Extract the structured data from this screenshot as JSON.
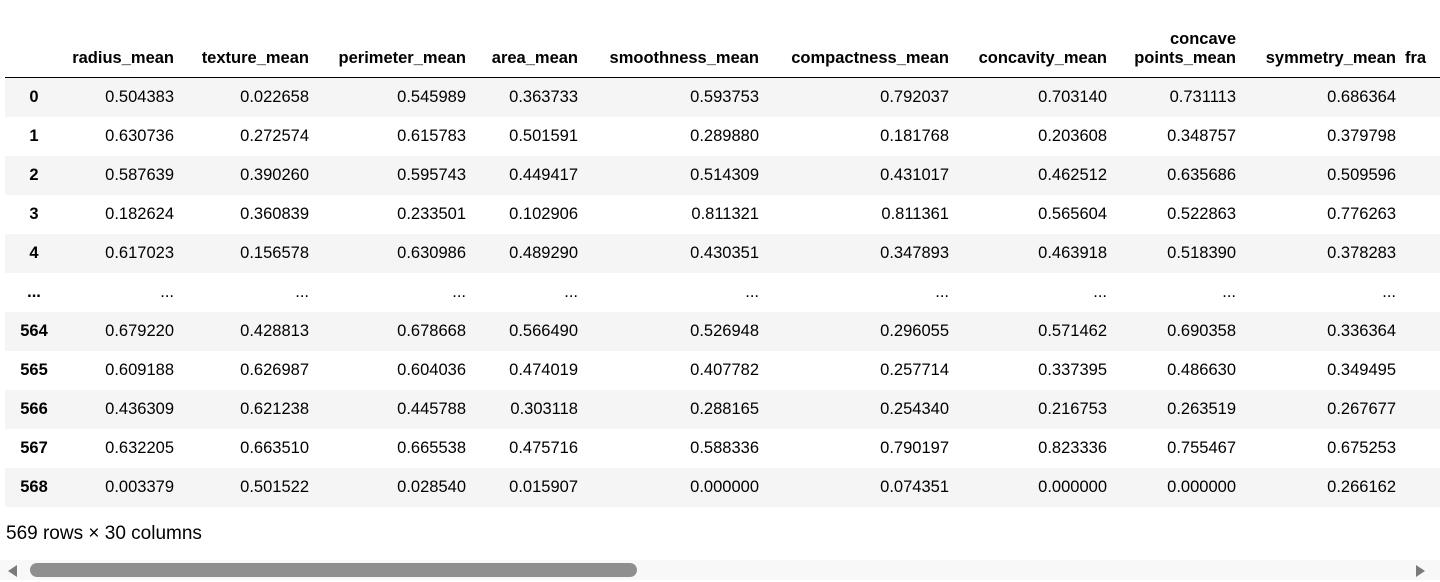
{
  "table": {
    "index_header": "",
    "columns": [
      [
        "radius_mean"
      ],
      [
        "texture_mean"
      ],
      [
        "perimeter_mean"
      ],
      [
        "area_mean"
      ],
      [
        "smoothness_mean"
      ],
      [
        "compactness_mean"
      ],
      [
        "concavity_mean"
      ],
      [
        "concave",
        "points_mean"
      ],
      [
        "symmetry_mean"
      ],
      [
        "fra"
      ]
    ],
    "rows": [
      {
        "index": "0",
        "cells": [
          "0.504383",
          "0.022658",
          "0.545989",
          "0.363733",
          "0.593753",
          "0.792037",
          "0.703140",
          "0.731113",
          "0.686364",
          ""
        ]
      },
      {
        "index": "1",
        "cells": [
          "0.630736",
          "0.272574",
          "0.615783",
          "0.501591",
          "0.289880",
          "0.181768",
          "0.203608",
          "0.348757",
          "0.379798",
          ""
        ]
      },
      {
        "index": "2",
        "cells": [
          "0.587639",
          "0.390260",
          "0.595743",
          "0.449417",
          "0.514309",
          "0.431017",
          "0.462512",
          "0.635686",
          "0.509596",
          ""
        ]
      },
      {
        "index": "3",
        "cells": [
          "0.182624",
          "0.360839",
          "0.233501",
          "0.102906",
          "0.811321",
          "0.811361",
          "0.565604",
          "0.522863",
          "0.776263",
          ""
        ]
      },
      {
        "index": "4",
        "cells": [
          "0.617023",
          "0.156578",
          "0.630986",
          "0.489290",
          "0.430351",
          "0.347893",
          "0.463918",
          "0.518390",
          "0.378283",
          ""
        ]
      },
      {
        "index": "...",
        "cells": [
          "...",
          "...",
          "...",
          "...",
          "...",
          "...",
          "...",
          "...",
          "...",
          ""
        ]
      },
      {
        "index": "564",
        "cells": [
          "0.679220",
          "0.428813",
          "0.678668",
          "0.566490",
          "0.526948",
          "0.296055",
          "0.571462",
          "0.690358",
          "0.336364",
          ""
        ]
      },
      {
        "index": "565",
        "cells": [
          "0.609188",
          "0.626987",
          "0.604036",
          "0.474019",
          "0.407782",
          "0.257714",
          "0.337395",
          "0.486630",
          "0.349495",
          ""
        ]
      },
      {
        "index": "566",
        "cells": [
          "0.436309",
          "0.621238",
          "0.445788",
          "0.303118",
          "0.288165",
          "0.254340",
          "0.216753",
          "0.263519",
          "0.267677",
          ""
        ]
      },
      {
        "index": "567",
        "cells": [
          "0.632205",
          "0.663510",
          "0.665538",
          "0.475716",
          "0.588336",
          "0.790197",
          "0.823336",
          "0.755467",
          "0.675253",
          ""
        ]
      },
      {
        "index": "568",
        "cells": [
          "0.003379",
          "0.501522",
          "0.028540",
          "0.015907",
          "0.000000",
          "0.074351",
          "0.000000",
          "0.000000",
          "0.266162",
          ""
        ]
      }
    ]
  },
  "footer": {
    "shape_text": "569 rows × 30 columns"
  },
  "scrollbar": {
    "left_arrow_icon": "triangle-left-icon",
    "right_arrow_icon": "triangle-right-icon"
  }
}
